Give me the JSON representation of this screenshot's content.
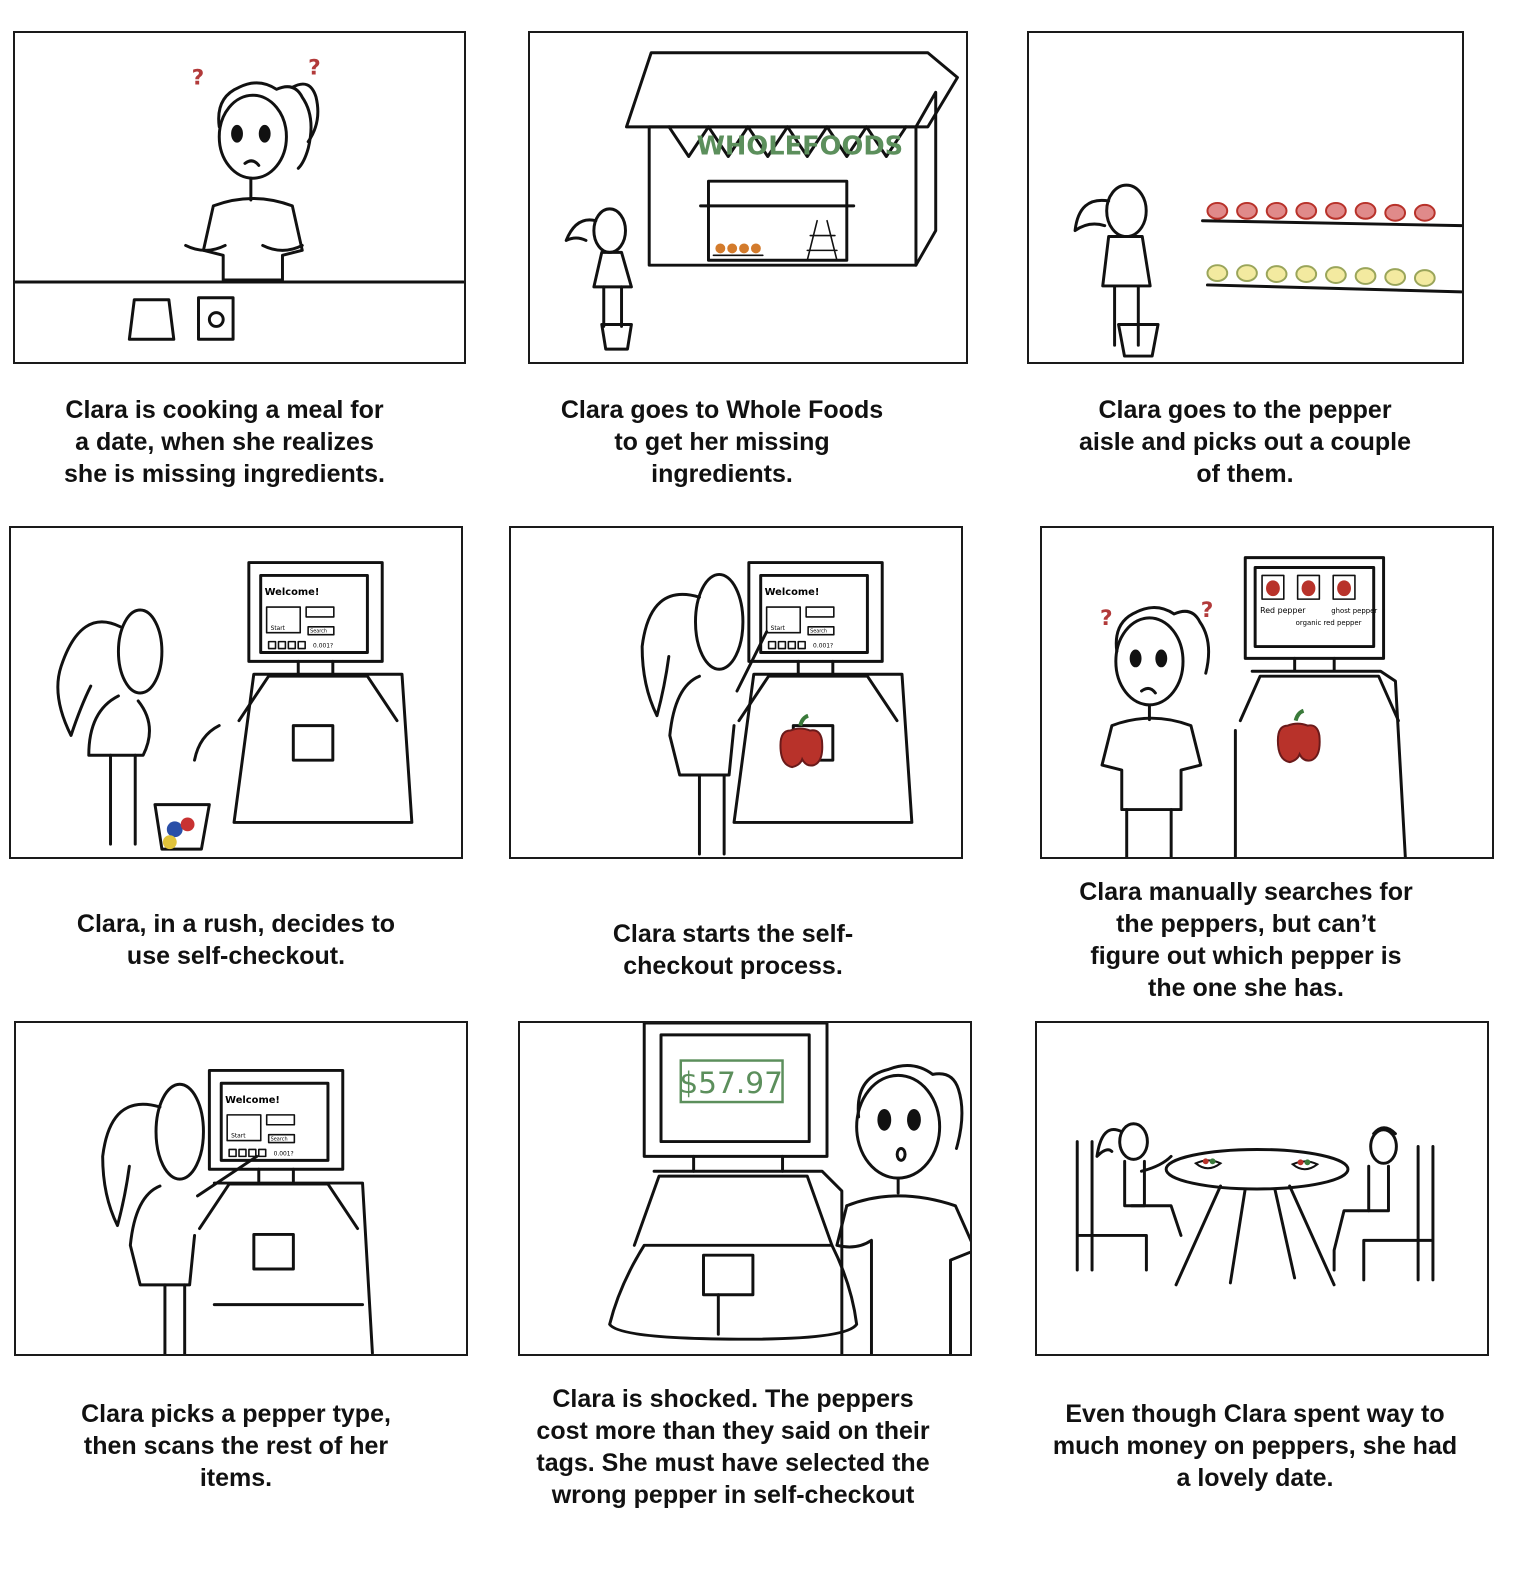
{
  "captions": {
    "p1": "Clara is cooking a meal for\na date, when she realizes\nshe is missing ingredients.",
    "p2": "Clara goes to Whole Foods\nto get her missing\ningredients.",
    "p3": "Clara goes to the pepper\naisle and picks out a couple\nof them.",
    "p4": "Clara, in a rush, decides to\nuse self-checkout.",
    "p5": "Clara starts the self-\ncheckout process.",
    "p6": "Clara manually searches for\nthe peppers, but can’t\nfigure out which pepper is\nthe one she has.",
    "p7": "Clara picks a pepper type,\nthen scans the rest of her\nitems.",
    "p8": "Clara is shocked. The peppers\ncost more than they said on their\ntags. She must have selected the\nwrong pepper in self-checkout",
    "p9": "Even though Clara spent way to\nmuch money on peppers, she had\na lovely date."
  },
  "store_sign": "WHOLEFOODS",
  "question_mark": "?",
  "kiosk_screen": {
    "welcome": "Welcome!",
    "start": "Start",
    "bags": "BYE my own bags",
    "search": "Search",
    "code": "0.001?"
  },
  "pepper_options": [
    "Red pepper",
    "organic red pepper",
    "ghost pepper"
  ],
  "price_display": "$57.97",
  "colors": {
    "ink": "#111111",
    "sign_green": "#5c8f5c",
    "pepper_red": "#b8322a",
    "question_red": "#b23a3a"
  }
}
